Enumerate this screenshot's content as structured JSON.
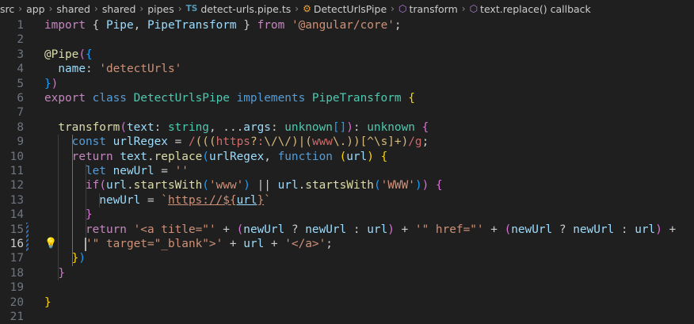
{
  "breadcrumb": {
    "items": [
      "src",
      "app",
      "shared",
      "shared",
      "pipes"
    ],
    "file_badge": "TS",
    "file": "detect-urls.pipe.ts",
    "class_symbol": "DetectUrlsPipe",
    "method_symbol": "transform",
    "callback_symbol": "text.replace() callback"
  },
  "editor": {
    "line_numbers": [
      "1",
      "2",
      "3",
      "4",
      "5",
      "6",
      "7",
      "8",
      "9",
      "10",
      "11",
      "12",
      "13",
      "14",
      "15",
      "16",
      "17",
      "18",
      "19",
      "20",
      "21"
    ],
    "active_line": "16",
    "lines": [
      [
        [
          "k",
          "import "
        ],
        [
          "t",
          "{ "
        ],
        [
          "v",
          "Pipe"
        ],
        [
          "t",
          ", "
        ],
        [
          "v",
          "PipeTransform"
        ],
        [
          "t",
          " } "
        ],
        [
          "k",
          "from "
        ],
        [
          "s",
          "'@angular/core'"
        ],
        [
          "t",
          ";"
        ]
      ],
      [],
      [
        [
          "f",
          "@Pipe"
        ],
        [
          "p2",
          "("
        ],
        [
          "p3",
          "{"
        ]
      ],
      [
        [
          "t",
          "  "
        ],
        [
          "v",
          "name"
        ],
        [
          "t",
          ": "
        ],
        [
          "s",
          "'detectUrls'"
        ]
      ],
      [
        [
          "p3",
          "}"
        ],
        [
          "p2",
          ")"
        ]
      ],
      [
        [
          "k",
          "export "
        ],
        [
          "kb",
          "class "
        ],
        [
          "c",
          "DetectUrlsPipe "
        ],
        [
          "kb",
          "implements "
        ],
        [
          "c",
          "PipeTransform "
        ],
        [
          "p1",
          "{"
        ]
      ],
      [],
      [
        [
          "t",
          "  "
        ],
        [
          "f",
          "transform"
        ],
        [
          "p2",
          "("
        ],
        [
          "v",
          "text"
        ],
        [
          "t",
          ": "
        ],
        [
          "c",
          "string"
        ],
        [
          "t",
          ", ..."
        ],
        [
          "v",
          "args"
        ],
        [
          "t",
          ": "
        ],
        [
          "c",
          "unknown"
        ],
        [
          "p3",
          "[]"
        ],
        [
          "p2",
          ")"
        ],
        [
          "t",
          ": "
        ],
        [
          "c",
          "unknown "
        ],
        [
          "p2",
          "{"
        ]
      ],
      [
        [
          "t",
          "    "
        ],
        [
          "kb",
          "const "
        ],
        [
          "v",
          "urlRegex"
        ],
        [
          "t",
          " = "
        ],
        [
          "re",
          "/"
        ],
        [
          "rq",
          "((("
        ],
        [
          "re",
          "https"
        ],
        [
          "rq",
          "?"
        ],
        [
          "re",
          ":"
        ],
        [
          "rq",
          "\\/\\/"
        ],
        [
          "rq",
          ")|("
        ],
        [
          "re",
          "www"
        ],
        [
          "rq",
          "\\."
        ],
        [
          "rq",
          "))"
        ],
        [
          "rq",
          "[^\\s]+"
        ],
        [
          "rq",
          ")"
        ],
        [
          "re",
          "/g"
        ],
        [
          "t",
          ";"
        ]
      ],
      [
        [
          "t",
          "    "
        ],
        [
          "k",
          "return "
        ],
        [
          "v",
          "text"
        ],
        [
          "t",
          "."
        ],
        [
          "f",
          "replace"
        ],
        [
          "p3",
          "("
        ],
        [
          "v",
          "urlRegex"
        ],
        [
          "t",
          ", "
        ],
        [
          "kb",
          "function "
        ],
        [
          "p1",
          "("
        ],
        [
          "v",
          "url"
        ],
        [
          "p1",
          ")"
        ],
        [
          "t",
          " "
        ],
        [
          "p1",
          "{"
        ]
      ],
      [
        [
          "t",
          "      "
        ],
        [
          "kb",
          "let "
        ],
        [
          "v",
          "newUrl"
        ],
        [
          "t",
          " = "
        ],
        [
          "s",
          "''"
        ]
      ],
      [
        [
          "t",
          "      "
        ],
        [
          "k",
          "if"
        ],
        [
          "p2",
          "("
        ],
        [
          "v",
          "url"
        ],
        [
          "t",
          "."
        ],
        [
          "f",
          "startsWith"
        ],
        [
          "p3",
          "("
        ],
        [
          "s",
          "'www'"
        ],
        [
          "p3",
          ")"
        ],
        [
          "t",
          " || "
        ],
        [
          "v",
          "url"
        ],
        [
          "t",
          "."
        ],
        [
          "f",
          "startsWith"
        ],
        [
          "p3",
          "("
        ],
        [
          "s",
          "'WWW'"
        ],
        [
          "p3",
          ")"
        ],
        [
          "p2",
          ")"
        ],
        [
          "t",
          " "
        ],
        [
          "p2",
          "{"
        ]
      ],
      [
        [
          "t",
          "        "
        ],
        [
          "v",
          "newUrl"
        ],
        [
          "t",
          " = "
        ],
        [
          "s",
          "`"
        ],
        [
          "su",
          "https://${"
        ],
        [
          "vu",
          "url"
        ],
        [
          "su",
          "}"
        ],
        [
          "s",
          "`"
        ]
      ],
      [
        [
          "t",
          "      "
        ],
        [
          "p2",
          "}"
        ]
      ],
      [
        [
          "t",
          "      "
        ],
        [
          "k",
          "return "
        ],
        [
          "s",
          "'<a title=\"'"
        ],
        [
          "t",
          " + "
        ],
        [
          "p2",
          "("
        ],
        [
          "v",
          "newUrl"
        ],
        [
          "t",
          " ? "
        ],
        [
          "v",
          "newUrl"
        ],
        [
          "t",
          " : "
        ],
        [
          "v",
          "url"
        ],
        [
          "p2",
          ")"
        ],
        [
          "t",
          " + "
        ],
        [
          "s",
          "'\" href=\"'"
        ],
        [
          "t",
          " + "
        ],
        [
          "p2",
          "("
        ],
        [
          "v",
          "newUrl"
        ],
        [
          "t",
          " ? "
        ],
        [
          "v",
          "newUrl"
        ],
        [
          "t",
          " : "
        ],
        [
          "v",
          "url"
        ],
        [
          "p2",
          ")"
        ],
        [
          "t",
          " +"
        ]
      ],
      [
        [
          "t",
          "      "
        ],
        [
          "s",
          "'\" target=\"_blank\">'"
        ],
        [
          "t",
          " + "
        ],
        [
          "v",
          "url"
        ],
        [
          "t",
          " + "
        ],
        [
          "s",
          "'</a>'"
        ],
        [
          "t",
          ";"
        ]
      ],
      [
        [
          "t",
          "    "
        ],
        [
          "p1",
          "}"
        ],
        [
          "p3",
          ")"
        ]
      ],
      [
        [
          "t",
          "  "
        ],
        [
          "p2",
          "}"
        ]
      ],
      [],
      [
        [
          "p1",
          "}"
        ]
      ],
      []
    ]
  },
  "colors": {
    "background": "#1f1f1f",
    "keyword_control": "#c586c0",
    "keyword": "#569cd6",
    "type": "#4ec9b0",
    "function": "#dcdcaa",
    "string": "#ce9178",
    "variable": "#9cdcfe"
  }
}
